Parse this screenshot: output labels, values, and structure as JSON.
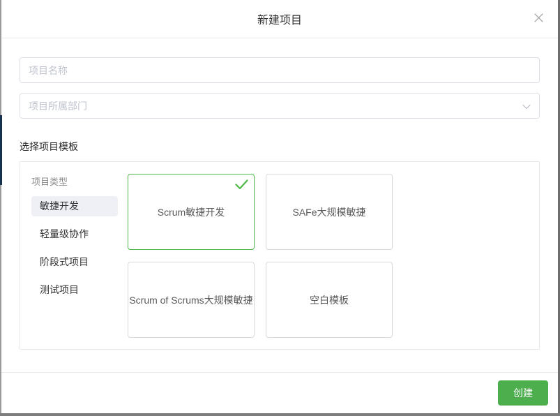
{
  "dialog": {
    "title": "新建项目"
  },
  "form": {
    "name_placeholder": "项目名称",
    "department_placeholder": "项目所属部门",
    "template_section_label": "选择项目模板"
  },
  "template_picker": {
    "category_label": "项目类型",
    "categories": [
      {
        "label": "敏捷开发",
        "selected": true
      },
      {
        "label": "轻量级协作",
        "selected": false
      },
      {
        "label": "阶段式项目",
        "selected": false
      },
      {
        "label": "测试项目",
        "selected": false
      }
    ],
    "templates": [
      {
        "label": "Scrum敏捷开发",
        "selected": true
      },
      {
        "label": "SAFe大规模敏捷",
        "selected": false
      },
      {
        "label": "Scrum of Scrums大规模敏捷",
        "selected": false
      },
      {
        "label": "空白模板",
        "selected": false
      }
    ]
  },
  "footer": {
    "create_label": "创建"
  },
  "colors": {
    "accent_button_green": "#4cae4c",
    "selected_green": "#4db848",
    "selected_category_bg": "#eef0f6",
    "input_border": "#dcdfe6",
    "panel_border": "#e8e8e8",
    "card_border": "#d9d9d9",
    "placeholder_text": "#bfc4ce"
  }
}
